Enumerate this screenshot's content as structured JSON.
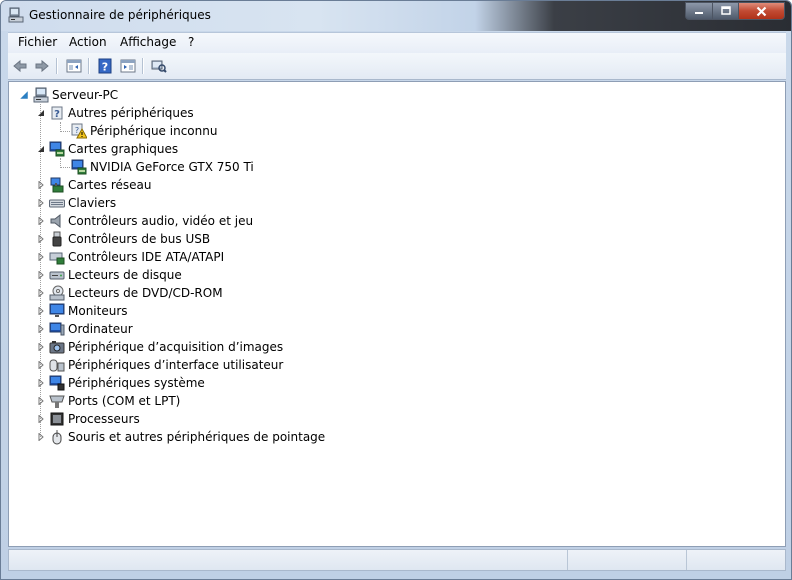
{
  "window": {
    "title": "Gestionnaire de périphériques"
  },
  "menu": {
    "items": [
      "Fichier",
      "Action",
      "Affichage",
      "?"
    ]
  },
  "toolbar": {
    "buttons": [
      "back-icon",
      "forward-icon",
      "console-tree-icon",
      "help-icon",
      "properties-icon",
      "scan-hardware-icon"
    ]
  },
  "tree": {
    "root": "Serveur-PC",
    "categories": [
      {
        "label": "Autres périphériques",
        "icon": "unknown-device-icon",
        "expanded": true,
        "children": [
          "Périphérique inconnu"
        ]
      },
      {
        "label": "Cartes graphiques",
        "icon": "display-adapter-icon",
        "expanded": true,
        "children": [
          "NVIDIA GeForce GTX 750 Ti"
        ]
      },
      {
        "label": "Cartes réseau",
        "icon": "network-adapter-icon"
      },
      {
        "label": "Claviers",
        "icon": "keyboard-icon"
      },
      {
        "label": "Contrôleurs audio, vidéo et jeu",
        "icon": "speaker-icon"
      },
      {
        "label": "Contrôleurs de bus USB",
        "icon": "usb-icon"
      },
      {
        "label": "Contrôleurs IDE ATA/ATAPI",
        "icon": "ide-controller-icon"
      },
      {
        "label": "Lecteurs de disque",
        "icon": "disk-drive-icon"
      },
      {
        "label": "Lecteurs de DVD/CD-ROM",
        "icon": "dvd-drive-icon"
      },
      {
        "label": "Moniteurs",
        "icon": "monitor-icon"
      },
      {
        "label": "Ordinateur",
        "icon": "computer-icon"
      },
      {
        "label": "Périphérique d’acquisition d’images",
        "icon": "camera-icon"
      },
      {
        "label": "Périphériques d’interface utilisateur",
        "icon": "hid-icon"
      },
      {
        "label": "Périphériques système",
        "icon": "system-device-icon"
      },
      {
        "label": "Ports (COM et LPT)",
        "icon": "port-icon"
      },
      {
        "label": "Processeurs",
        "icon": "processor-icon"
      },
      {
        "label": "Souris et autres périphériques de pointage",
        "icon": "mouse-icon"
      }
    ]
  },
  "colors": {
    "selection": "#cce8ff",
    "titlebar_dark": "#2a2d33",
    "close_button": "#c14a33"
  }
}
